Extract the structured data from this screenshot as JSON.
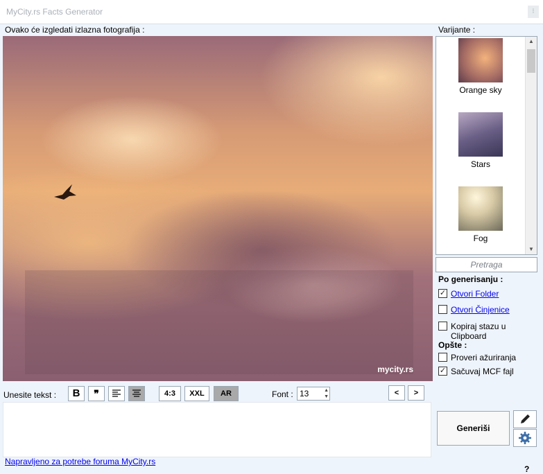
{
  "window": {
    "title": "MyCity.rs Facts Generator"
  },
  "preview": {
    "label": "Ovako će izgledati izlazna fotografija :",
    "watermark": "mycity.rs"
  },
  "variants": {
    "label": "Varijante :",
    "items": [
      {
        "label": "Orange sky"
      },
      {
        "label": "Stars"
      },
      {
        "label": "Fog"
      }
    ]
  },
  "search": {
    "placeholder": "Pretraga"
  },
  "after_generate": {
    "heading": "Po generisanju :",
    "options": [
      {
        "label": "Otvori Folder",
        "checked": true,
        "link": true
      },
      {
        "label": "Otvori Činjenice",
        "checked": false,
        "link": true
      },
      {
        "label": "Kopiraj stazu u Clipboard",
        "checked": false,
        "link": false
      }
    ]
  },
  "general": {
    "heading": "Opšte :",
    "options": [
      {
        "label": "Proveri ažuriranja",
        "checked": false
      },
      {
        "label": "Sačuvaj MCF fajl",
        "checked": true
      }
    ]
  },
  "toolbar": {
    "text_label": "Unesite tekst :",
    "bold": "B",
    "quote": "❞",
    "ratio": "4:3",
    "size": "XXL",
    "ar": "AR",
    "font_label": "Font :",
    "font_value": "13",
    "prev": "<",
    "next": ">"
  },
  "actions": {
    "generate": "Generiši"
  },
  "footer": {
    "link": "Napravljeno za potrebe foruma MyCity.rs",
    "help": "?"
  },
  "icons": {
    "pencil": "pencil-icon",
    "gear": "gear-icon"
  }
}
